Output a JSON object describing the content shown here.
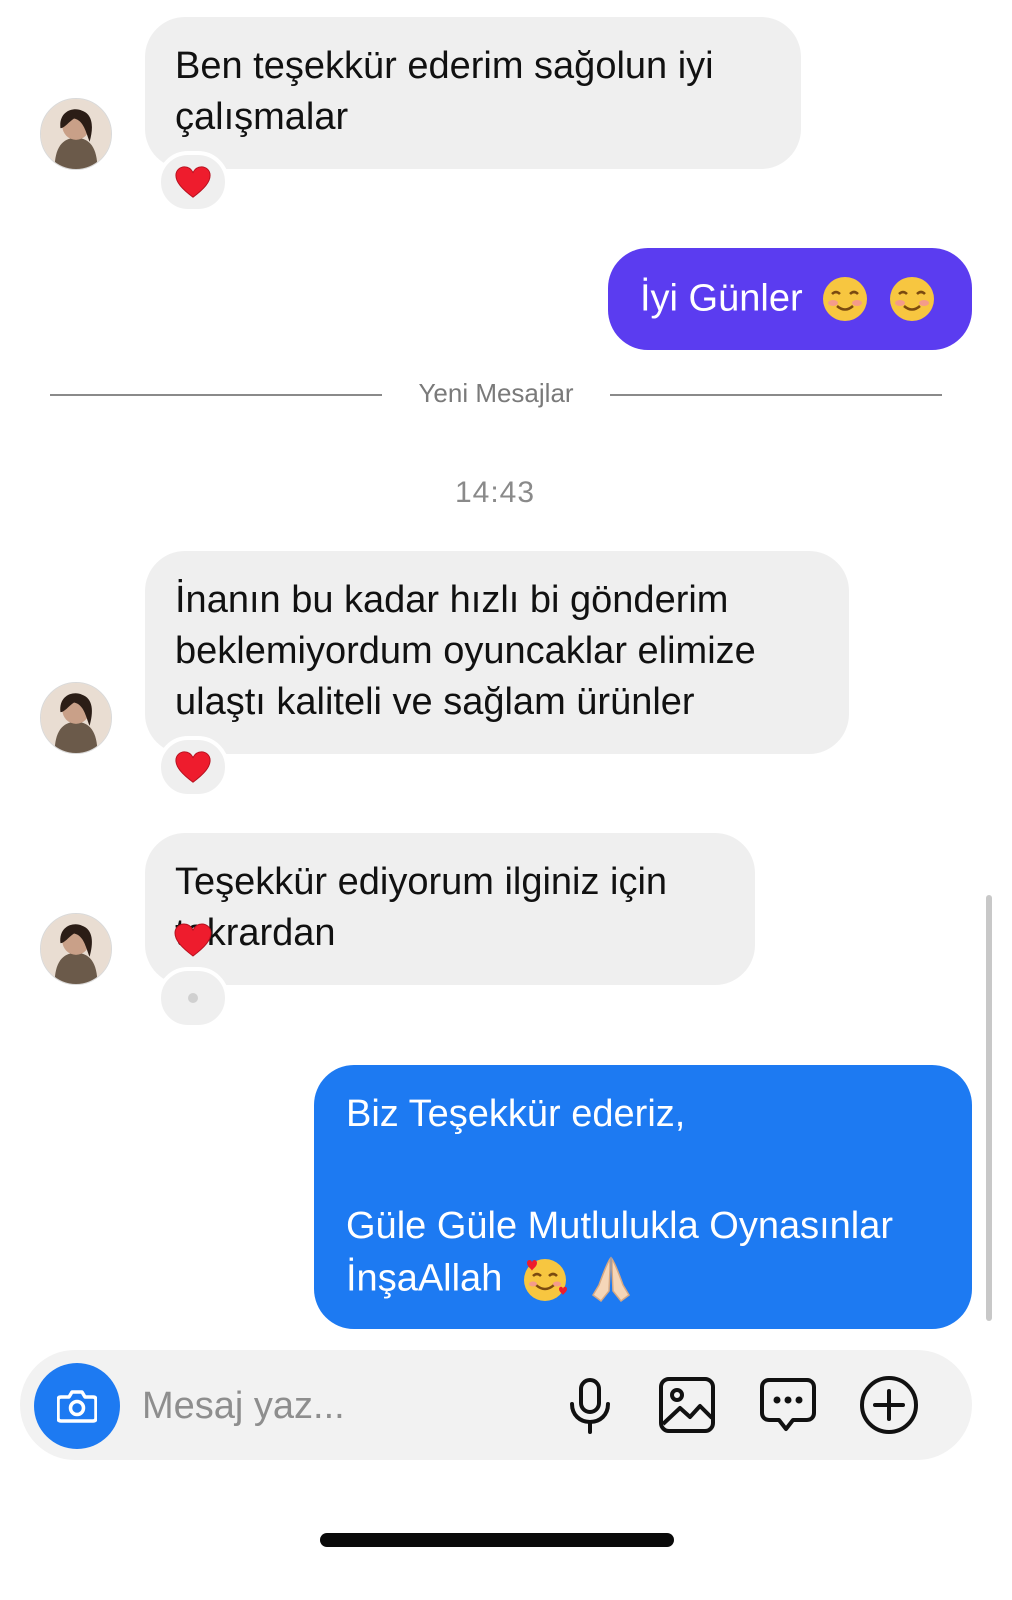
{
  "messages": [
    {
      "text": "Ben teşekkür ederim sağolun iyi\nçalışmalar",
      "reaction": "heart"
    },
    {
      "text": "İyi Günler",
      "emoji": [
        "smiling-face-icon",
        "smiling-face-icon"
      ]
    },
    {
      "text": "İnanın bu kadar hızlı bi gönderim\nbeklemiyordum oyuncaklar elimize\nulaştı kaliteli ve sağlam ürünler",
      "reaction": "heart"
    },
    {
      "text": "Teşekkür ediyorum ilginiz için\ntekrardan",
      "reaction": "heart"
    },
    {
      "text_line1": "Biz Teşekkür ederiz,",
      "text_line2": "Güle Güle Mutlulukla Oynasınlar",
      "text_line3": "İnşaAllah",
      "emoji": [
        "smiling-face-with-hearts-icon",
        "folded-hands-icon"
      ]
    }
  ],
  "divider": {
    "label": "Yeni Mesajlar"
  },
  "timestamp": "14:43",
  "composer": {
    "placeholder": "Mesaj yaz..."
  },
  "colors": {
    "incoming_bubble": "#efefef",
    "outgoing_bubble_1": "#5b3cf0",
    "outgoing_bubble_2": "#1d7af2",
    "accent": "#1d7af2"
  },
  "icons": [
    "camera-icon",
    "microphone-icon",
    "image-icon",
    "sticker-chat-icon",
    "plus-circle-icon",
    "heart-icon"
  ]
}
